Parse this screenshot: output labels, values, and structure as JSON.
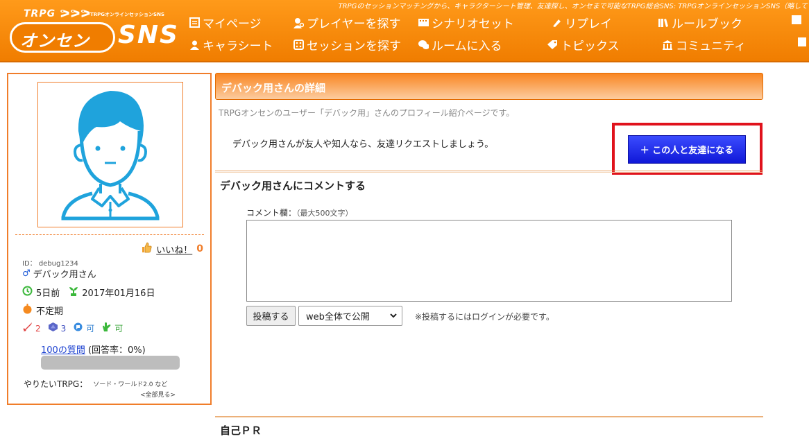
{
  "header": {
    "tagline": "TRPGのセッションマッチングから、キャラクターシート管理、友達探し、オンセまで可能なTRPG総合SNS: TRPGオンラインセッションSNS（略して",
    "logo": {
      "trpg": "TRPG",
      "sub": "TRPGオンラインセッションSNS",
      "main": "オンセン",
      "sns": "SNS"
    },
    "nav": [
      {
        "label": "マイページ",
        "icon": "mypage-icon"
      },
      {
        "label": "プレイヤーを探す",
        "icon": "player-search-icon"
      },
      {
        "label": "シナリオセット",
        "icon": "scenario-icon"
      },
      {
        "label": "リプレイ",
        "icon": "replay-icon"
      },
      {
        "label": "ルールブック",
        "icon": "rulebook-icon"
      },
      {
        "label": "キャラシート",
        "icon": "charasheet-icon"
      },
      {
        "label": "セッションを探す",
        "icon": "dice-icon"
      },
      {
        "label": "ルームに入る",
        "icon": "room-icon"
      },
      {
        "label": "トピックス",
        "icon": "topics-icon"
      },
      {
        "label": "コミュニティ",
        "icon": "community-icon"
      }
    ]
  },
  "sidebar": {
    "like_label": "いいね！",
    "like_count": "0",
    "user_id": "ID： debug1234",
    "gender_symbol": "♂",
    "user_name": "デバック用さん",
    "last_login": "5日前",
    "registered": "2017年01月16日",
    "frequency": "不定期",
    "stat1": "2",
    "stat2": "3",
    "stat3": "可",
    "stat4": "可",
    "questions_link": "100の質問",
    "questions_rate": "(回答率：0%)",
    "questions_progress": 0,
    "want_label": "やりたいTRPG：",
    "want_games": "ソード・ワールド2.0 など",
    "want_all": "<全部見る>"
  },
  "main": {
    "title": "デバック用さんの詳細",
    "intro": "TRPGオンセンのユーザー「デバック用」さんのプロフィール紹介ページです。",
    "friend_text": "デバック用さんが友人や知人なら、友達リクエストしましょう。",
    "friend_button": "＋ この人と友達になる",
    "comment_heading": "デバック用さんにコメントする",
    "comment_label": "コメント欄：",
    "comment_hint": "（最大500文字）",
    "post_button": "投稿する",
    "visibility_selected": "web全体で公開",
    "login_note": "※投稿するにはログインが必要です。",
    "pr_heading": "自己ＰＲ"
  }
}
